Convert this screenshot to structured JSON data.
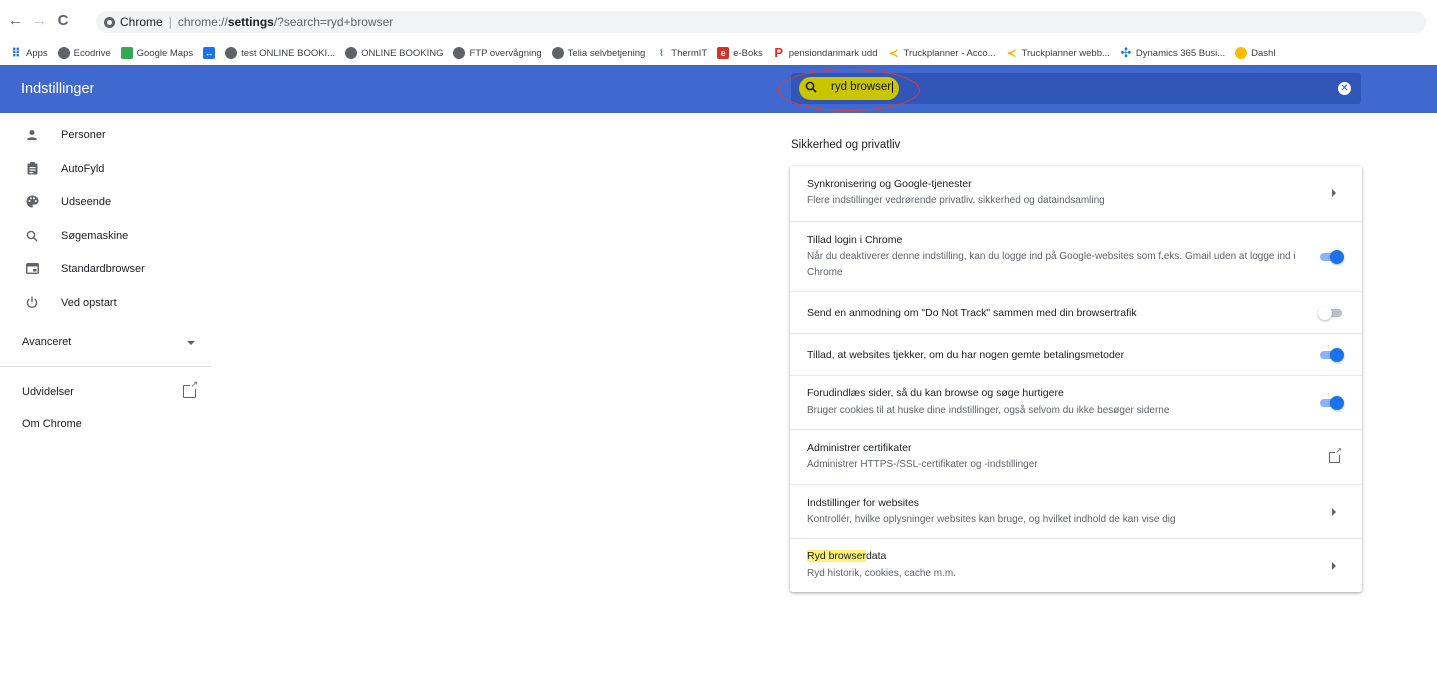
{
  "browser": {
    "back": "←",
    "forward": "→",
    "reload": "C",
    "tab_label": "Chrome",
    "url_prefix": "chrome://",
    "url_bold": "settings",
    "url_rest": "/?search=ryd+browser"
  },
  "bookmarks": [
    {
      "icon": "apps-icon",
      "label": "Apps"
    },
    {
      "icon": "globe-icon",
      "label": "Ecodrive"
    },
    {
      "icon": "google-maps-icon",
      "label": "Google Maps"
    },
    {
      "icon": "teamviewer-icon",
      "label": ""
    },
    {
      "icon": "globe-icon",
      "label": "test ONLINE BOOKI..."
    },
    {
      "icon": "globe-icon",
      "label": "ONLINE BOOKING"
    },
    {
      "icon": "globe-icon",
      "label": "FTP overvågning"
    },
    {
      "icon": "globe-icon",
      "label": "Telia selvbetjening"
    },
    {
      "icon": "thermit-icon",
      "label": "ThermIT"
    },
    {
      "icon": "eboks-icon",
      "label": "e-Boks"
    },
    {
      "icon": "pension-icon",
      "label": "pensiondanmark udd"
    },
    {
      "icon": "truckplanner-icon",
      "label": "Truckplanner - Acco..."
    },
    {
      "icon": "truckplanner-icon",
      "label": "Truckplanner webb..."
    },
    {
      "icon": "dynamics-icon",
      "label": "Dynamics 365 Busi..."
    },
    {
      "icon": "dashboard-icon",
      "label": "Dashl"
    }
  ],
  "header": {
    "title": "Indstillinger",
    "search_value": "ryd browser"
  },
  "sidebar": {
    "items": [
      {
        "icon": "person-icon",
        "label": "Personer"
      },
      {
        "icon": "clipboard-icon",
        "label": "AutoFyld"
      },
      {
        "icon": "palette-icon",
        "label": "Udseende"
      },
      {
        "icon": "search-icon",
        "label": "Søgemaskine"
      },
      {
        "icon": "browser-icon",
        "label": "Standardbrowser"
      },
      {
        "icon": "power-icon",
        "label": "Ved opstart"
      }
    ],
    "advanced": "Avanceret",
    "extensions": "Udvidelser",
    "about": "Om Chrome"
  },
  "section": {
    "title": "Sikkerhed og privatliv",
    "rows": [
      {
        "title": "Synkronisering og Google-tjenester",
        "sub": "Flere indstillinger vedrørende privatliv, sikkerhed og dataindsamling",
        "control": "chevron"
      },
      {
        "title": "Tillad login i Chrome",
        "sub": "Når du deaktiverer denne indstilling, kan du logge ind på Google-websites som f.eks. Gmail uden at logge ind i Chrome",
        "control": "toggle-on"
      },
      {
        "title": "Send en anmodning om \"Do Not Track\" sammen med din browsertrafik",
        "sub": "",
        "control": "toggle-off"
      },
      {
        "title": "Tillad, at websites tjekker, om du har nogen gemte betalingsmetoder",
        "sub": "",
        "control": "toggle-on"
      },
      {
        "title": "Forudindlæs sider, så du kan browse og søge hurtigere",
        "sub": "Bruger cookies til at huske dine indstillinger, også selvom du ikke besøger siderne",
        "control": "toggle-on"
      },
      {
        "title": "Administrer certifikater",
        "sub": "Administrer HTTPS-/SSL-certifikater og -indstillinger",
        "control": "open"
      },
      {
        "title": "Indstillinger for websites",
        "sub": "Kontrollér, hvilke oplysninger websites kan bruge, og hvilket indhold de kan vise dig",
        "control": "chevron"
      }
    ],
    "last_row": {
      "title_highlight": "Ryd browser",
      "title_rest": "data",
      "sub": "Ryd historik, cookies, cache m.m."
    }
  }
}
